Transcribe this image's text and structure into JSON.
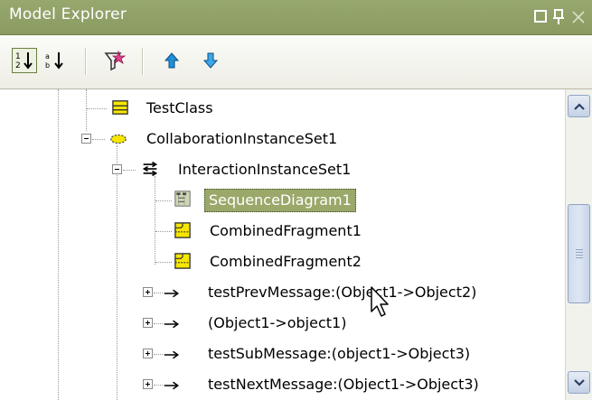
{
  "window": {
    "title": "Model Explorer",
    "controls": [
      "maximize",
      "pin",
      "close"
    ]
  },
  "toolbar": {
    "buttons": [
      {
        "name": "sort-by-type",
        "icon": "sort-numeric-icon",
        "pressed": true
      },
      {
        "name": "sort-alphabetically",
        "icon": "sort-alpha-icon",
        "pressed": false
      },
      {
        "name": "filter",
        "icon": "filter-icon",
        "pressed": false
      },
      {
        "name": "move-up",
        "icon": "arrow-up-icon",
        "pressed": false
      },
      {
        "name": "move-down",
        "icon": "arrow-down-icon",
        "pressed": false
      }
    ]
  },
  "tree": {
    "items": [
      {
        "label": "TestClass",
        "icon": "class-icon",
        "expander": "none",
        "selected": false
      },
      {
        "label": "CollaborationInstanceSet1",
        "icon": "collaboration-icon",
        "expander": "minus",
        "selected": false
      },
      {
        "label": "InteractionInstanceSet1",
        "icon": "interaction-icon",
        "expander": "minus",
        "selected": false
      },
      {
        "label": "SequenceDiagram1",
        "icon": "sequence-diagram-icon",
        "expander": "none",
        "selected": true
      },
      {
        "label": "CombinedFragment1",
        "icon": "combined-fragment-icon",
        "expander": "none",
        "selected": false
      },
      {
        "label": "CombinedFragment2",
        "icon": "combined-fragment-icon",
        "expander": "none",
        "selected": false
      },
      {
        "label": "testPrevMessage:(Object1->Object2)",
        "icon": "message-arrow-icon",
        "expander": "plus",
        "selected": false
      },
      {
        "label": "(Object1->object1)",
        "icon": "message-arrow-icon",
        "expander": "plus",
        "selected": false
      },
      {
        "label": "testSubMessage:(object1->Object3)",
        "icon": "message-arrow-icon",
        "expander": "plus",
        "selected": false
      },
      {
        "label": "testNextMessage:(Object1->Object3)",
        "icon": "message-arrow-icon",
        "expander": "plus",
        "selected": false
      }
    ]
  },
  "colors": {
    "titlebar": "#8fa066",
    "selection": "#9aa86a",
    "scrollbar_accent": "#8fa3c4"
  }
}
